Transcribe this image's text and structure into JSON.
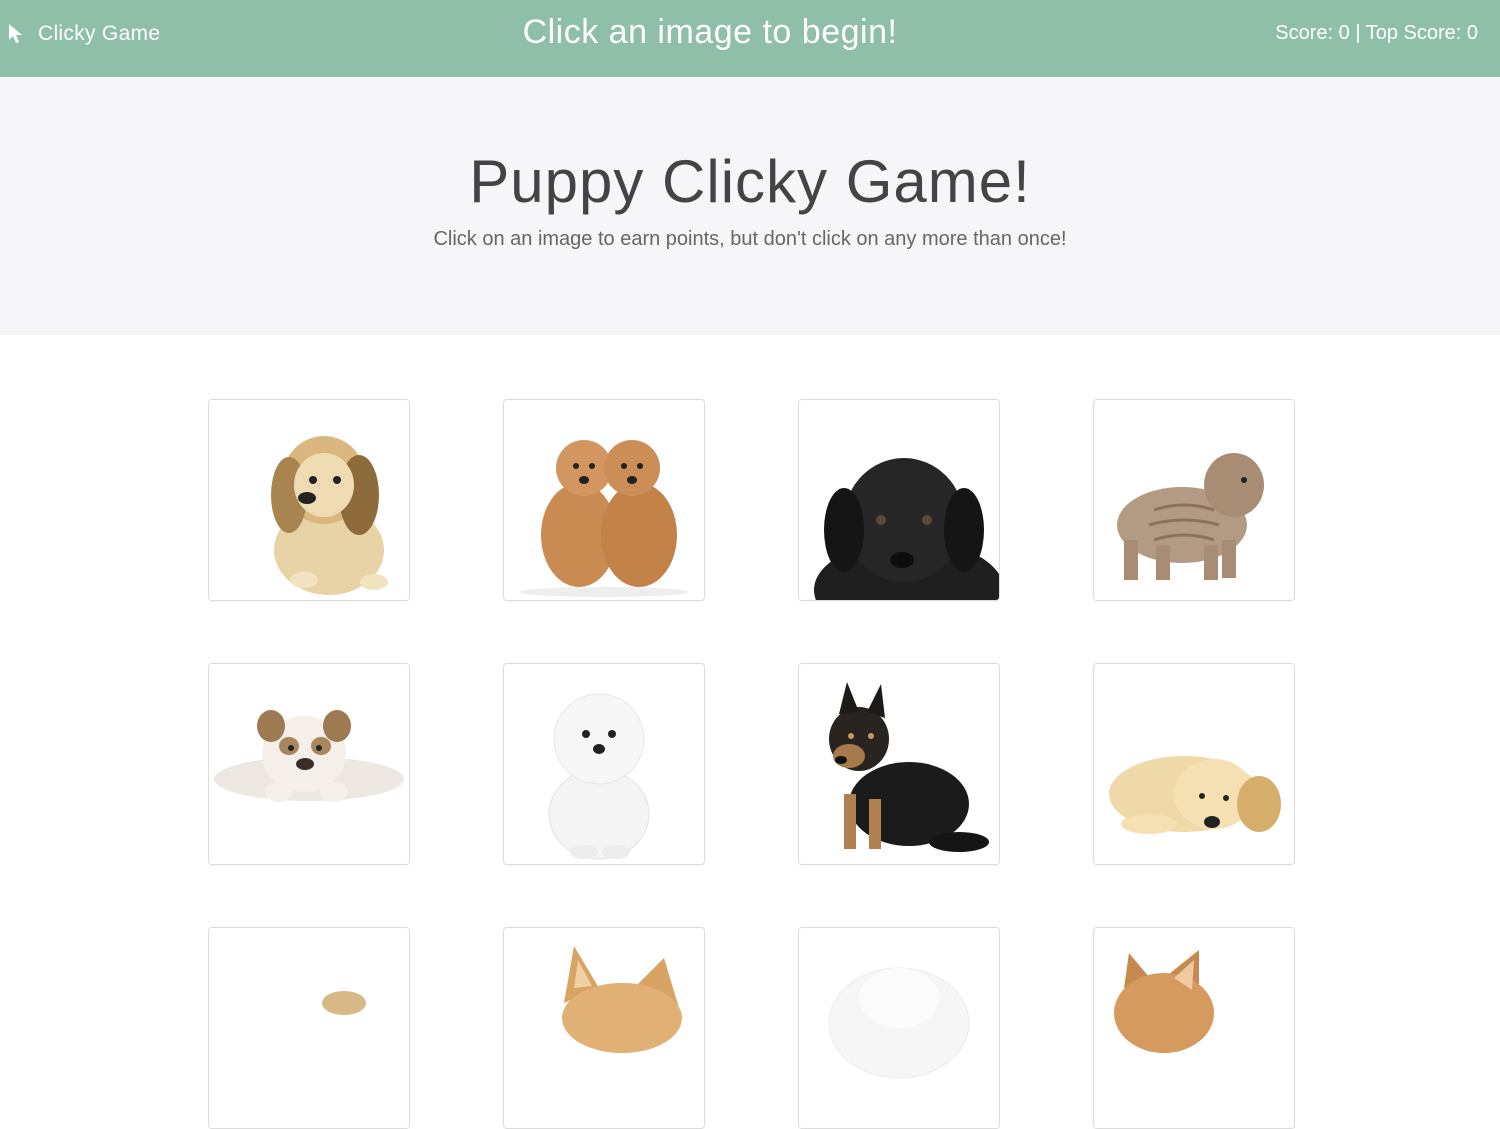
{
  "navbar": {
    "brand_label": "Clicky Game",
    "brand_icon": "cursor-pointer-icon",
    "message": "Click an image to begin!",
    "score_text": "Score: 0 | Top Score: 0",
    "color": "#8fbfa9"
  },
  "jumbotron": {
    "title": "Puppy Clicky Game!",
    "subtitle": "Click on an image to earn points, but don't click on any more than once!",
    "background": "#f6f6f8"
  },
  "cards": [
    {
      "icon": "puppy-dachshund-image"
    },
    {
      "icon": "puppy-poodles-image"
    },
    {
      "icon": "puppy-black-lab-image"
    },
    {
      "icon": "puppy-shar-pei-image"
    },
    {
      "icon": "puppy-bulldog-image"
    },
    {
      "icon": "puppy-maltese-image"
    },
    {
      "icon": "puppy-german-shepherd-image"
    },
    {
      "icon": "puppy-golden-retriever-image"
    },
    {
      "icon": "puppy-image-9"
    },
    {
      "icon": "puppy-corgi-ears-image"
    },
    {
      "icon": "puppy-white-fluffy-image"
    },
    {
      "icon": "puppy-corgi-image"
    }
  ]
}
